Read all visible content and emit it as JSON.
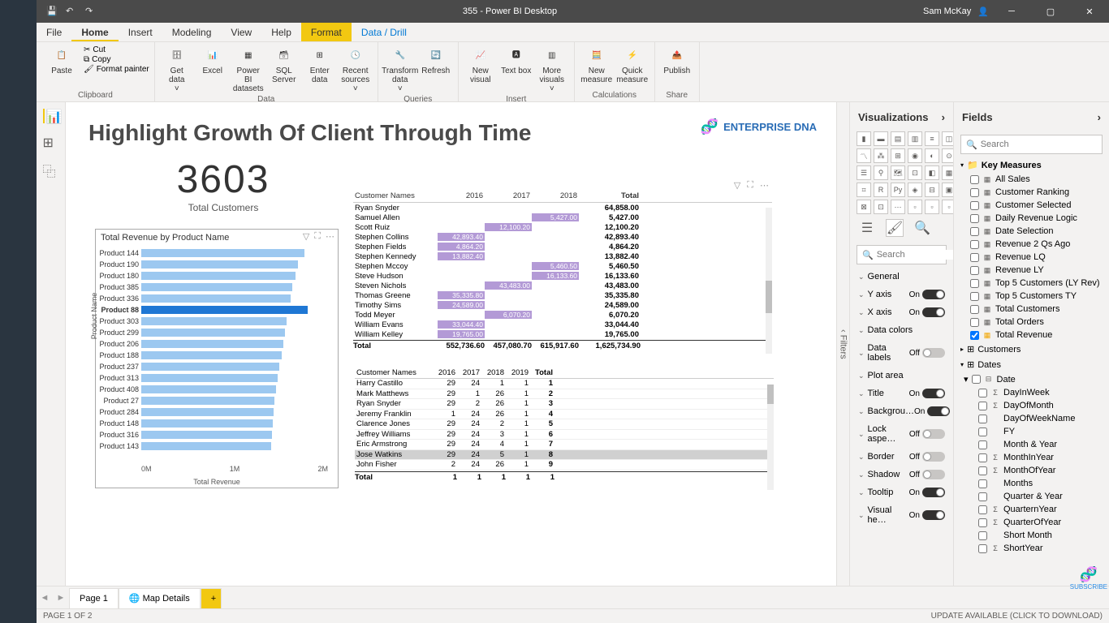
{
  "title": "355 - Power BI Desktop",
  "user": "Sam McKay",
  "tabs": {
    "file": "File",
    "home": "Home",
    "insert": "Insert",
    "modeling": "Modeling",
    "view": "View",
    "help": "Help",
    "format": "Format",
    "data_drill": "Data / Drill"
  },
  "ribbon": {
    "clipboard": {
      "paste": "Paste",
      "cut": "Cut",
      "copy": "Copy",
      "painter": "Format painter",
      "label": "Clipboard"
    },
    "data": {
      "get": "Get data",
      "excel": "Excel",
      "pbi": "Power BI datasets",
      "sql": "SQL Server",
      "enter": "Enter data",
      "recent": "Recent sources",
      "label": "Data"
    },
    "queries": {
      "transform": "Transform data",
      "refresh": "Refresh",
      "label": "Queries"
    },
    "insert": {
      "nv": "New visual",
      "tb": "Text box",
      "mv": "More visuals",
      "label": "Insert"
    },
    "calc": {
      "nm": "New measure",
      "qm": "Quick measure",
      "label": "Calculations"
    },
    "share": {
      "publish": "Publish",
      "label": "Share"
    }
  },
  "report": {
    "title": "Highlight Growth Of Client Through Time",
    "logo": "ENTERPRISE DNA",
    "kpi_value": "3603",
    "kpi_label": "Total Customers"
  },
  "chart_data": {
    "type": "bar",
    "title": "Total Revenue by Product Name",
    "xlabel": "Total Revenue",
    "ylabel": "Product Name",
    "xticks": [
      "0M",
      "1M",
      "2M"
    ],
    "xlim": [
      0,
      2000000
    ],
    "highlight": "Product 88",
    "series": [
      {
        "name": "Product 144",
        "value": 1750000
      },
      {
        "name": "Product 190",
        "value": 1680000
      },
      {
        "name": "Product 180",
        "value": 1650000
      },
      {
        "name": "Product 385",
        "value": 1620000
      },
      {
        "name": "Product 336",
        "value": 1600000
      },
      {
        "name": "Product 88",
        "value": 1780000
      },
      {
        "name": "Product 303",
        "value": 1560000
      },
      {
        "name": "Product 299",
        "value": 1540000
      },
      {
        "name": "Product 206",
        "value": 1520000
      },
      {
        "name": "Product 188",
        "value": 1500000
      },
      {
        "name": "Product 237",
        "value": 1480000
      },
      {
        "name": "Product 313",
        "value": 1460000
      },
      {
        "name": "Product 408",
        "value": 1440000
      },
      {
        "name": "Product 27",
        "value": 1430000
      },
      {
        "name": "Product 284",
        "value": 1420000
      },
      {
        "name": "Product 148",
        "value": 1410000
      },
      {
        "name": "Product 316",
        "value": 1400000
      },
      {
        "name": "Product 143",
        "value": 1390000
      }
    ]
  },
  "matrix1": {
    "headers": [
      "Customer Names",
      "2016",
      "2017",
      "2018",
      "Total"
    ],
    "rows": [
      {
        "name": "Ryan Snyder",
        "y16": "",
        "y17": "",
        "y18": "",
        "total": "64,858.00",
        "hl": []
      },
      {
        "name": "Samuel Allen",
        "y16": "",
        "y17": "",
        "y18": "5,427.00",
        "total": "5,427.00",
        "hl": [
          "y18"
        ]
      },
      {
        "name": "Scott Ruiz",
        "y16": "",
        "y17": "12,100.20",
        "y18": "",
        "total": "12,100.20",
        "hl": [
          "y17"
        ]
      },
      {
        "name": "Stephen Collins",
        "y16": "42,893.40",
        "y17": "",
        "y18": "",
        "total": "42,893.40",
        "hl": [
          "y16"
        ]
      },
      {
        "name": "Stephen Fields",
        "y16": "4,864.20",
        "y17": "",
        "y18": "",
        "total": "4,864.20",
        "hl": [
          "y16"
        ]
      },
      {
        "name": "Stephen Kennedy",
        "y16": "13,882.40",
        "y17": "",
        "y18": "",
        "total": "13,882.40",
        "hl": [
          "y16"
        ]
      },
      {
        "name": "Stephen Mccoy",
        "y16": "",
        "y17": "",
        "y18": "5,460.50",
        "total": "5,460.50",
        "hl": [
          "y18"
        ]
      },
      {
        "name": "Steve Hudson",
        "y16": "",
        "y17": "",
        "y18": "16,133.60",
        "total": "16,133.60",
        "hl": [
          "y18"
        ]
      },
      {
        "name": "Steven Nichols",
        "y16": "",
        "y17": "43,483.00",
        "y18": "",
        "total": "43,483.00",
        "hl": [
          "y17"
        ]
      },
      {
        "name": "Thomas Greene",
        "y16": "35,335.80",
        "y17": "",
        "y18": "",
        "total": "35,335.80",
        "hl": [
          "y16"
        ]
      },
      {
        "name": "Timothy Sims",
        "y16": "24,589.00",
        "y17": "",
        "y18": "",
        "total": "24,589.00",
        "hl": [
          "y16"
        ]
      },
      {
        "name": "Todd Meyer",
        "y16": "",
        "y17": "6,070.20",
        "y18": "",
        "total": "6,070.20",
        "hl": [
          "y17"
        ]
      },
      {
        "name": "William Evans",
        "y16": "33,044.40",
        "y17": "",
        "y18": "",
        "total": "33,044.40",
        "hl": [
          "y16"
        ]
      },
      {
        "name": "William Kelley",
        "y16": "19,765.00",
        "y17": "",
        "y18": "",
        "total": "19,765.00",
        "hl": [
          "y16"
        ]
      }
    ],
    "total": {
      "name": "Total",
      "y16": "552,736.60",
      "y17": "457,080.70",
      "y18": "615,917.60",
      "total": "1,625,734.90"
    }
  },
  "matrix2": {
    "headers": [
      "Customer Names",
      "2016",
      "2017",
      "2018",
      "2019",
      "Total"
    ],
    "rows": [
      {
        "name": "Harry Castillo",
        "v": [
          "29",
          "24",
          "1",
          "1",
          "1"
        ]
      },
      {
        "name": "Mark Matthews",
        "v": [
          "29",
          "1",
          "26",
          "1",
          "2"
        ]
      },
      {
        "name": "Ryan Snyder",
        "v": [
          "29",
          "2",
          "26",
          "1",
          "3"
        ]
      },
      {
        "name": "Jeremy Franklin",
        "v": [
          "1",
          "24",
          "26",
          "1",
          "4"
        ]
      },
      {
        "name": "Clarence Jones",
        "v": [
          "29",
          "24",
          "2",
          "1",
          "5"
        ]
      },
      {
        "name": "Jeffrey Williams",
        "v": [
          "29",
          "24",
          "3",
          "1",
          "6"
        ]
      },
      {
        "name": "Eric Armstrong",
        "v": [
          "29",
          "24",
          "4",
          "1",
          "7"
        ]
      },
      {
        "name": "Jose Watkins",
        "v": [
          "29",
          "24",
          "5",
          "1",
          "8"
        ],
        "sel": true
      },
      {
        "name": "John Fisher",
        "v": [
          "2",
          "24",
          "26",
          "1",
          "9"
        ]
      }
    ],
    "total": {
      "name": "Total",
      "v": [
        "1",
        "1",
        "1",
        "1",
        "1"
      ]
    }
  },
  "viz_panel": {
    "title": "Visualizations",
    "search": "Search"
  },
  "format_items": [
    {
      "label": "General",
      "toggle": null
    },
    {
      "label": "Y axis",
      "toggle": "On"
    },
    {
      "label": "X axis",
      "toggle": "On"
    },
    {
      "label": "Data colors",
      "toggle": null
    },
    {
      "label": "Data labels",
      "toggle": "Off"
    },
    {
      "label": "Plot area",
      "toggle": null
    },
    {
      "label": "Title",
      "toggle": "On"
    },
    {
      "label": "Backgrou…",
      "toggle": "On"
    },
    {
      "label": "Lock aspe…",
      "toggle": "Off"
    },
    {
      "label": "Border",
      "toggle": "Off"
    },
    {
      "label": "Shadow",
      "toggle": "Off"
    },
    {
      "label": "Tooltip",
      "toggle": "On"
    },
    {
      "label": "Visual he…",
      "toggle": "On"
    }
  ],
  "fields_panel": {
    "title": "Fields",
    "search": "Search",
    "key_measures": "Key Measures",
    "measures": [
      {
        "label": "All Sales",
        "checked": false
      },
      {
        "label": "Customer Ranking",
        "checked": false
      },
      {
        "label": "Customer Selected",
        "checked": false
      },
      {
        "label": "Daily Revenue Logic",
        "checked": false
      },
      {
        "label": "Date Selection",
        "checked": false
      },
      {
        "label": "Revenue 2 Qs Ago",
        "checked": false
      },
      {
        "label": "Revenue LQ",
        "checked": false
      },
      {
        "label": "Revenue LY",
        "checked": false
      },
      {
        "label": "Top 5 Customers (LY Rev)",
        "checked": false
      },
      {
        "label": "Top 5 Customers TY",
        "checked": false
      },
      {
        "label": "Total Customers",
        "checked": false
      },
      {
        "label": "Total Orders",
        "checked": false
      },
      {
        "label": "Total Revenue",
        "checked": true
      }
    ],
    "tables": [
      {
        "label": "Customers",
        "icon": "table"
      },
      {
        "label": "Dates",
        "icon": "table",
        "expanded": true
      }
    ],
    "dates": {
      "label": "Date",
      "icon": "hier",
      "checked": false,
      "cols": [
        {
          "label": "DayInWeek",
          "icon": "Σ"
        },
        {
          "label": "DayOfMonth",
          "icon": "Σ"
        },
        {
          "label": "DayOfWeekName",
          "icon": ""
        },
        {
          "label": "FY",
          "icon": ""
        },
        {
          "label": "Month & Year",
          "icon": ""
        },
        {
          "label": "MonthInYear",
          "icon": "Σ"
        },
        {
          "label": "MonthOfYear",
          "icon": "Σ"
        },
        {
          "label": "Months",
          "icon": ""
        },
        {
          "label": "Quarter & Year",
          "icon": ""
        },
        {
          "label": "QuarternYear",
          "icon": "Σ"
        },
        {
          "label": "QuarterOfYear",
          "icon": "Σ"
        },
        {
          "label": "Short Month",
          "icon": ""
        },
        {
          "label": "ShortYear",
          "icon": "Σ"
        }
      ]
    }
  },
  "pages": {
    "p1": "Page 1",
    "p2": "Map Details"
  },
  "status": {
    "left": "PAGE 1 OF 2",
    "right": "UPDATE AVAILABLE (CLICK TO DOWNLOAD)"
  },
  "subscribe": "SUBSCRIBE"
}
